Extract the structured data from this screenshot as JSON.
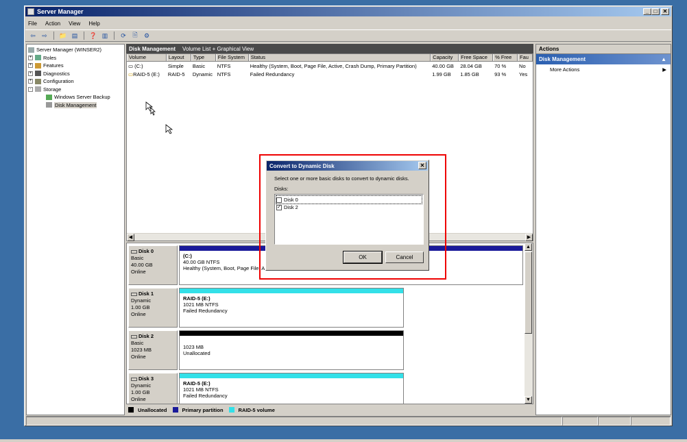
{
  "window": {
    "title": "Server Manager"
  },
  "menu": [
    "File",
    "Action",
    "View",
    "Help"
  ],
  "tree": {
    "root": "Server Manager (WINSER2)",
    "items": [
      {
        "label": "Roles",
        "level": 1,
        "expand": "+"
      },
      {
        "label": "Features",
        "level": 1,
        "expand": "+"
      },
      {
        "label": "Diagnostics",
        "level": 1,
        "expand": "+"
      },
      {
        "label": "Configuration",
        "level": 1,
        "expand": "+"
      },
      {
        "label": "Storage",
        "level": 1,
        "expand": "-"
      },
      {
        "label": "Windows Server Backup",
        "level": 2,
        "expand": ""
      },
      {
        "label": "Disk Management",
        "level": 2,
        "expand": "",
        "selected": true
      }
    ]
  },
  "center": {
    "title": "Disk Management",
    "subtitle": "Volume List + Graphical View"
  },
  "volume_list": {
    "columns": [
      "Volume",
      "Layout",
      "Type",
      "File System",
      "Status",
      "Capacity",
      "Free Space",
      "% Free",
      "Fau"
    ],
    "rows": [
      [
        "(C:)",
        "Simple",
        "Basic",
        "NTFS",
        "Healthy (System, Boot, Page File, Active, Crash Dump, Primary Partition)",
        "40.00 GB",
        "28.04 GB",
        "70 %",
        "No"
      ],
      [
        "RAID-5 (E:)",
        "RAID-5",
        "Dynamic",
        "NTFS",
        "Failed Redundancy",
        "1.99 GB",
        "1.85 GB",
        "93 %",
        "Yes"
      ]
    ]
  },
  "disks": [
    {
      "name": "Disk 0",
      "type": "Basic",
      "size": "40.00 GB",
      "state": "Online",
      "part_name": "(C:)",
      "part_size": "40.00 GB NTFS",
      "part_status": "Healthy (System, Boot, Page File, A"
    },
    {
      "name": "Disk 1",
      "type": "Dynamic",
      "size": "1.00 GB",
      "state": "Online",
      "part_name": "RAID-5  (E:)",
      "part_size": "1021 MB NTFS",
      "part_status": "Failed Redundancy"
    },
    {
      "name": "Disk 2",
      "type": "Basic",
      "size": "1023 MB",
      "state": "Online",
      "part_name": "",
      "part_size": "1023 MB",
      "part_status": "Unallocated"
    },
    {
      "name": "Disk 3",
      "type": "Dynamic",
      "size": "1.00 GB",
      "state": "Online",
      "part_name": "RAID-5  (E:)",
      "part_size": "1021 MB NTFS",
      "part_status": "Failed Redundancy"
    }
  ],
  "legend": [
    {
      "label": "Unallocated",
      "color": "#000000"
    },
    {
      "label": "Primary partition",
      "color": "#1a1a9a"
    },
    {
      "label": "RAID-5 volume",
      "color": "#33e0e8"
    }
  ],
  "actions": {
    "header": "Actions",
    "section": "Disk Management",
    "item": "More Actions"
  },
  "dialog": {
    "title": "Convert to Dynamic Disk",
    "instruction": "Select one or more basic disks to convert to dynamic disks.",
    "disks_label": "Disks:",
    "options": [
      {
        "label": "Disk 0",
        "checked": false
      },
      {
        "label": "Disk 2",
        "checked": true
      }
    ],
    "ok_label": "OK",
    "cancel_label": "Cancel"
  },
  "colors": {
    "accent": "#0a246a",
    "highlight": "#ee0000",
    "desktop": "#3a6ea5"
  }
}
